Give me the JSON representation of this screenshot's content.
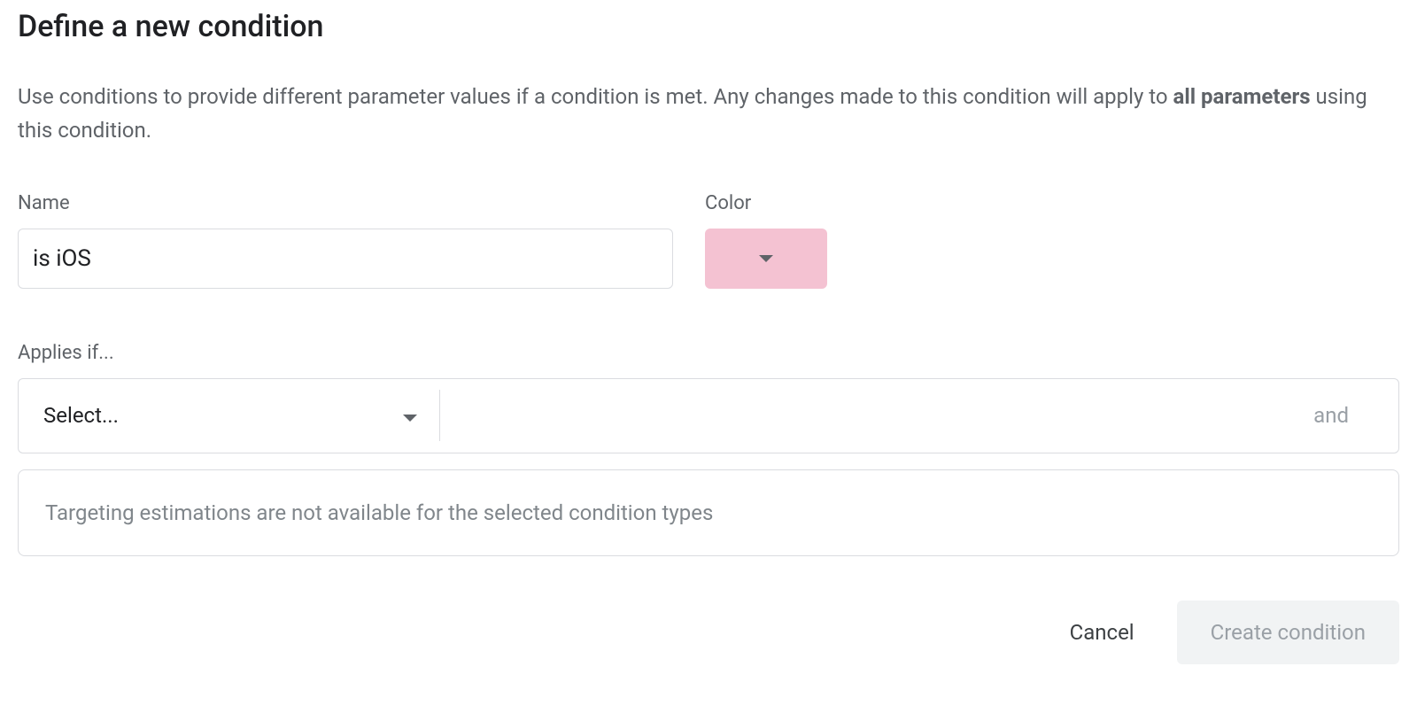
{
  "heading": "Define a new condition",
  "description": {
    "pre": "Use conditions to provide different parameter values if a condition is met. Any changes made to this condition will apply to ",
    "bold": "all parameters",
    "post": " using this condition."
  },
  "fields": {
    "name_label": "Name",
    "name_value": "is iOS",
    "color_label": "Color",
    "color_value": "#f4c2d2"
  },
  "applies": {
    "label": "Applies if...",
    "select_placeholder": "Select...",
    "and_label": "and"
  },
  "estimation": "Targeting estimations are not available for the selected condition types",
  "footer": {
    "cancel": "Cancel",
    "create": "Create condition"
  }
}
